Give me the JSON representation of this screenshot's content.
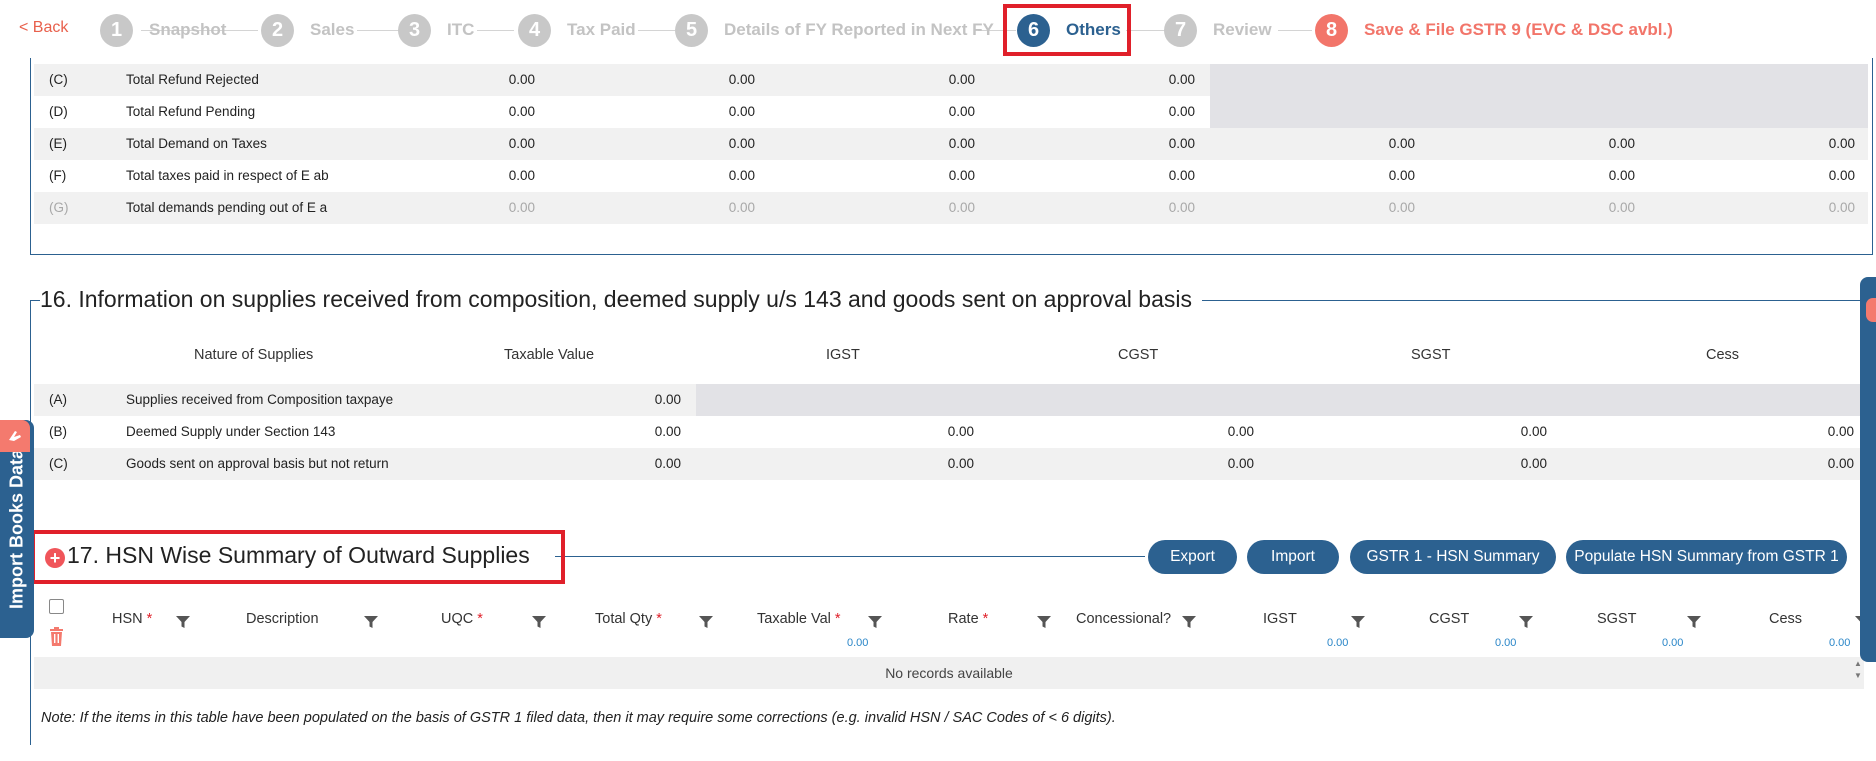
{
  "stepper": {
    "back_label": "< Back",
    "steps": [
      {
        "num": "1",
        "label": "Snapshot"
      },
      {
        "num": "2",
        "label": "Sales"
      },
      {
        "num": "3",
        "label": "ITC"
      },
      {
        "num": "4",
        "label": "Tax Paid"
      },
      {
        "num": "5",
        "label": "Details of FY Reported in Next FY"
      },
      {
        "num": "6",
        "label": "Others"
      },
      {
        "num": "7",
        "label": "Review"
      },
      {
        "num": "8",
        "label": "Save & File GSTR 9 (EVC & DSC avbl.)"
      }
    ],
    "active_step": "6"
  },
  "section15": {
    "rows": [
      {
        "code": "(C)",
        "label": "Total Refund Rejected",
        "values": [
          "0.00",
          "0.00",
          "0.00",
          "0.00"
        ]
      },
      {
        "code": "(D)",
        "label": "Total Refund Pending",
        "values": [
          "0.00",
          "0.00",
          "0.00",
          "0.00"
        ]
      },
      {
        "code": "(E)",
        "label": "Total Demand on Taxes",
        "values": [
          "0.00",
          "0.00",
          "0.00",
          "0.00",
          "0.00",
          "0.00",
          "0.00"
        ]
      },
      {
        "code": "(F)",
        "label": "Total taxes paid in respect of E ab",
        "values": [
          "0.00",
          "0.00",
          "0.00",
          "0.00",
          "0.00",
          "0.00",
          "0.00"
        ]
      },
      {
        "code": "(G)",
        "label": "Total demands pending out of E a",
        "values": [
          "0.00",
          "0.00",
          "0.00",
          "0.00",
          "0.00",
          "0.00",
          "0.00"
        ]
      }
    ]
  },
  "section16": {
    "title": "16. Information on supplies received from composition, deemed supply u/s 143 and goods sent on approval basis",
    "headers": [
      "Nature of Supplies",
      "Taxable Value",
      "IGST",
      "CGST",
      "SGST",
      "Cess"
    ],
    "rows": [
      {
        "code": "(A)",
        "label": "Supplies received from Composition taxpaye",
        "values": [
          "0.00"
        ]
      },
      {
        "code": "(B)",
        "label": "Deemed Supply under Section 143",
        "values": [
          "0.00",
          "0.00",
          "0.00",
          "0.00",
          "0.00"
        ]
      },
      {
        "code": "(C)",
        "label": "Goods sent on approval basis but not return",
        "values": [
          "0.00",
          "0.00",
          "0.00",
          "0.00",
          "0.00"
        ]
      }
    ]
  },
  "section17": {
    "title": "17. HSN Wise Summary of Outward Supplies",
    "buttons": {
      "export": "Export",
      "import": "Import",
      "gstr1": "GSTR 1 - HSN Summary",
      "populate": "Populate HSN Summary from GSTR 1"
    },
    "columns": [
      {
        "label": "HSN",
        "required": "*"
      },
      {
        "label": "Description",
        "required": ""
      },
      {
        "label": "UQC",
        "required": "*"
      },
      {
        "label": "Total Qty",
        "required": "*"
      },
      {
        "label": "Taxable Val",
        "required": "*"
      },
      {
        "label": "Rate",
        "required": "*"
      },
      {
        "label": "Concessional?",
        "required": ""
      },
      {
        "label": "IGST",
        "required": ""
      },
      {
        "label": "CGST",
        "required": ""
      },
      {
        "label": "SGST",
        "required": ""
      },
      {
        "label": "Cess",
        "required": ""
      }
    ],
    "totals": {
      "taxable": "0.00",
      "igst": "0.00",
      "cgst": "0.00",
      "sgst": "0.00",
      "cess": "0.00"
    },
    "empty_message": "No records available",
    "note": "Note: If the items in this table have been populated on the basis of GSTR 1 filed data, then it may require some corrections (e.g. invalid HSN / SAC Codes of < 6 digits)."
  },
  "side_tab": {
    "label": "Import Books Data"
  },
  "colors": {
    "primary": "#2c6190",
    "accent": "#f2756a",
    "highlight": "#e0202a"
  }
}
